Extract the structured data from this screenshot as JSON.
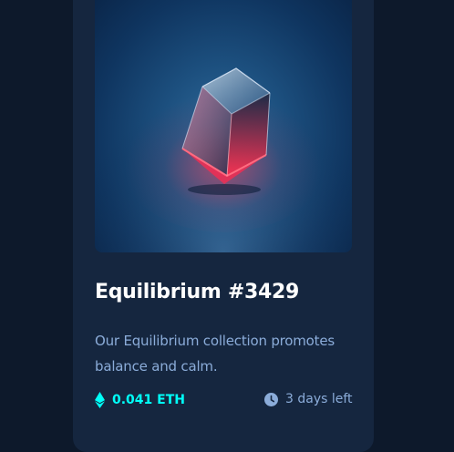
{
  "card": {
    "image_alt": "Equilibrium",
    "title": "Equilibrium #3429",
    "description": "Our Equilibrium collection promotes balance and calm.",
    "price": {
      "icon": "ethereum-icon",
      "value": "0.041 ETH"
    },
    "time_left": {
      "icon": "clock-icon",
      "value": "3 days left"
    }
  },
  "colors": {
    "page_background": "#0d192b",
    "card_background": "#15263f",
    "title": "#ffffff",
    "soft_blue": "#8bacd9",
    "cyan": "#00fff8"
  }
}
